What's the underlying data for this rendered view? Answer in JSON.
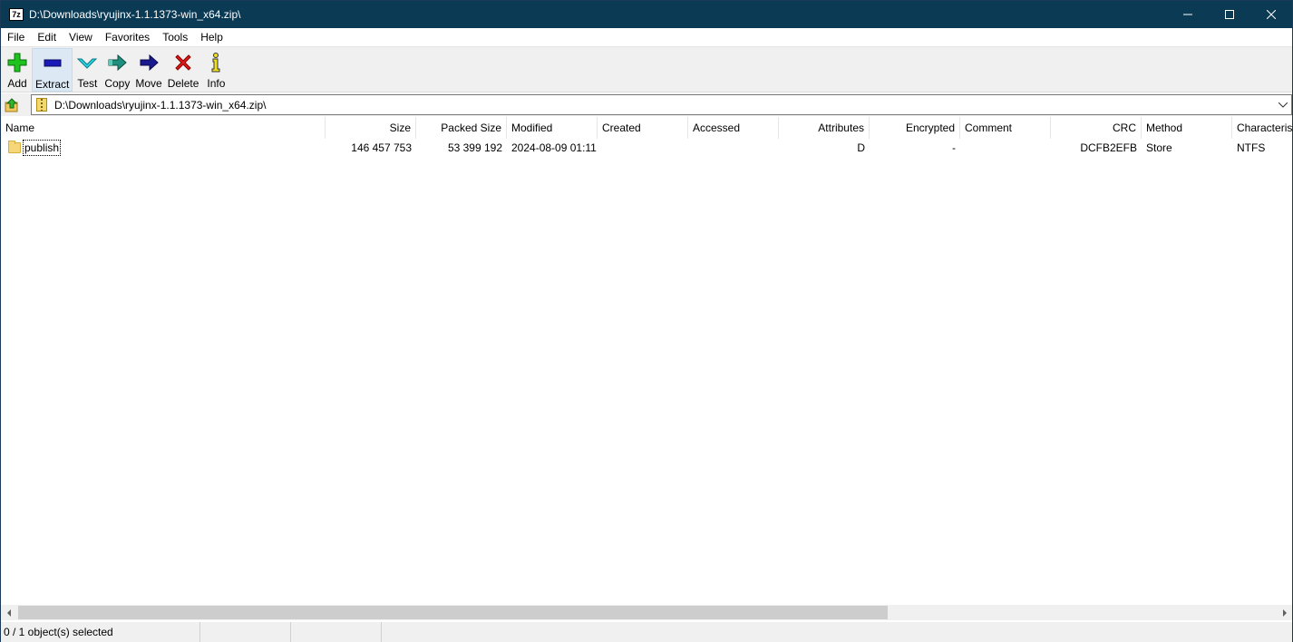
{
  "window": {
    "title": "D:\\Downloads\\ryujinx-1.1.1373-win_x64.zip\\",
    "app_icon_text": "7z"
  },
  "menu": [
    "File",
    "Edit",
    "View",
    "Favorites",
    "Tools",
    "Help"
  ],
  "toolbar": {
    "add": "Add",
    "extract": "Extract",
    "test": "Test",
    "copy": "Copy",
    "move": "Move",
    "delete": "Delete",
    "info": "Info"
  },
  "address": {
    "path": "D:\\Downloads\\ryujinx-1.1.1373-win_x64.zip\\"
  },
  "columns": {
    "name": "Name",
    "size": "Size",
    "packed_size": "Packed Size",
    "modified": "Modified",
    "created": "Created",
    "accessed": "Accessed",
    "attributes": "Attributes",
    "encrypted": "Encrypted",
    "comment": "Comment",
    "crc": "CRC",
    "method": "Method",
    "characteristics": "Characteris"
  },
  "rows": [
    {
      "name": "publish",
      "size": "146 457 753",
      "packed_size": "53 399 192",
      "modified": "2024-08-09 01:11",
      "created": "",
      "accessed": "",
      "attributes": "D",
      "encrypted": "-",
      "comment": "",
      "crc": "DCFB2EFB",
      "method": "Store",
      "characteristics": "NTFS"
    }
  ],
  "status": {
    "selection": "0 / 1 object(s) selected"
  },
  "colors": {
    "titlebar": "#0b3a55",
    "toolbar": "#f0f0f0",
    "add_green": "#1ec31e",
    "extract_blue": "#1a1ab8",
    "test_cyan": "#27d3e3",
    "copy_teal": "#1f8f7d",
    "move_navy": "#1a1a8f",
    "delete_red": "#e01818",
    "info_yellow": "#f0e020"
  },
  "icons": {
    "add": "plus-icon",
    "extract": "minus-icon",
    "test": "checkmark-icon",
    "copy": "arrow-right-icon",
    "move": "arrow-right-icon",
    "delete": "x-icon",
    "info": "info-icon"
  }
}
